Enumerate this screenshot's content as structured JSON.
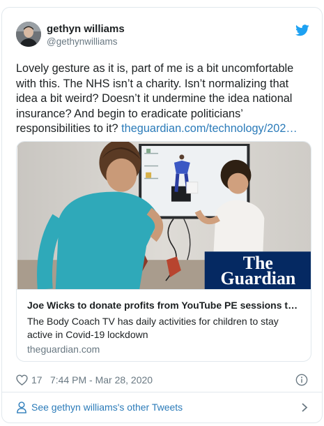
{
  "user": {
    "name": "gethyn williams",
    "handle": "@gethynwilliams"
  },
  "tweet": {
    "text": "Lovely gesture as it is, part of me is a bit uncomfortable with this. The NHS isn’t a charity. Isn’t normalizing that idea a bit weird? Doesn’t it undermine the idea national insurance? And begin to eradicate politicians’ responsibilities to it? ",
    "link_text": "theguardian.com/technology/202…"
  },
  "card": {
    "logo_line1": "The",
    "logo_line2": "Guardian",
    "title": "Joe Wicks to donate profits from YouTube PE sessions to NHS",
    "description": "The Body Coach TV has daily activities for children to stay active in Covid-19 lockdown",
    "domain": "theguardian.com"
  },
  "meta": {
    "likes": "17",
    "timestamp": "7:44 PM - Mar 28, 2020"
  },
  "footer": {
    "label": "See gethyn williams's other Tweets"
  },
  "colors": {
    "link": "#2b7bb9",
    "muted": "#697882",
    "twitter_blue": "#1da1f2",
    "guardian_blue": "#052962"
  },
  "icons": [
    "twitter-bird-icon",
    "heart-icon",
    "info-icon",
    "person-icon",
    "chevron-right-icon"
  ]
}
